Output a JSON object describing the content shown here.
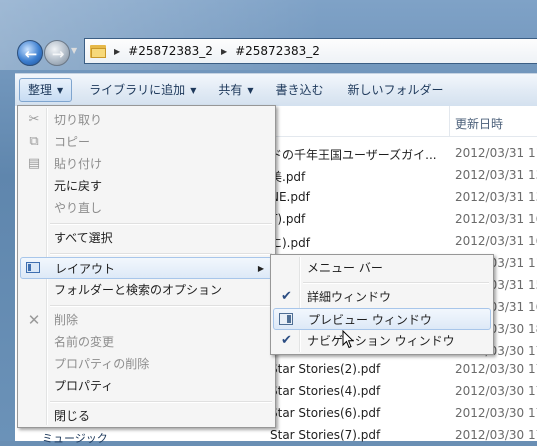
{
  "window": {
    "breadcrumb": [
      "#25872383_2",
      "#25872383_2"
    ]
  },
  "toolbar": {
    "organize": "整理",
    "add_to_library": "ライブラリに追加",
    "share": "共有",
    "burn": "書き込む",
    "new_folder": "新しいフォルダー"
  },
  "file_list": {
    "date_header": "更新日時",
    "rows": [
      {
        "name": "ドの千年王国ユーザーズガイ...",
        "date": "2012/03/31 11"
      },
      {
        "name": "美.pdf",
        "date": "2012/03/31 13"
      },
      {
        "name": "NE.pdf",
        "date": "2012/03/31 13"
      },
      {
        "name": "T).pdf",
        "date": "2012/03/31 16"
      },
      {
        "name": "に).pdf",
        "date": "2012/03/31 16"
      },
      {
        "name": "",
        "date": "2012/03/31 11"
      },
      {
        "name": "",
        "date": "2012/03/31 15"
      },
      {
        "name": "",
        "date": "2012/03/31 16"
      },
      {
        "name": "",
        "date": "2012/03/30 18"
      },
      {
        "name": "",
        "date": "2012/03/30 17"
      },
      {
        "name": "Star Stories(2).pdf",
        "date": "2012/03/30 17"
      },
      {
        "name": "Star Stories(4).pdf",
        "date": "2012/03/30 17"
      },
      {
        "name": "Star Stories(6).pdf",
        "date": "2012/03/30 17"
      },
      {
        "name": "Star Stories(7).pdf",
        "date": "2012/03/30 17"
      }
    ],
    "nav_pane_partial": "ミュージック"
  },
  "menu": {
    "cut": "切り取り",
    "copy": "コピー",
    "paste": "貼り付け",
    "undo": "元に戻す",
    "redo": "やり直し",
    "select_all": "すべて選択",
    "layout": "レイアウト",
    "folder_options": "フォルダーと検索のオプション",
    "delete": "削除",
    "rename": "名前の変更",
    "remove_properties": "プロパティの削除",
    "properties": "プロパティ",
    "close": "閉じる"
  },
  "submenu": {
    "menu_bar": "メニュー バー",
    "details_pane": "詳細ウィンドウ",
    "preview_pane": "プレビュー ウィンドウ",
    "navigation_pane": "ナビゲーション ウィンドウ"
  }
}
